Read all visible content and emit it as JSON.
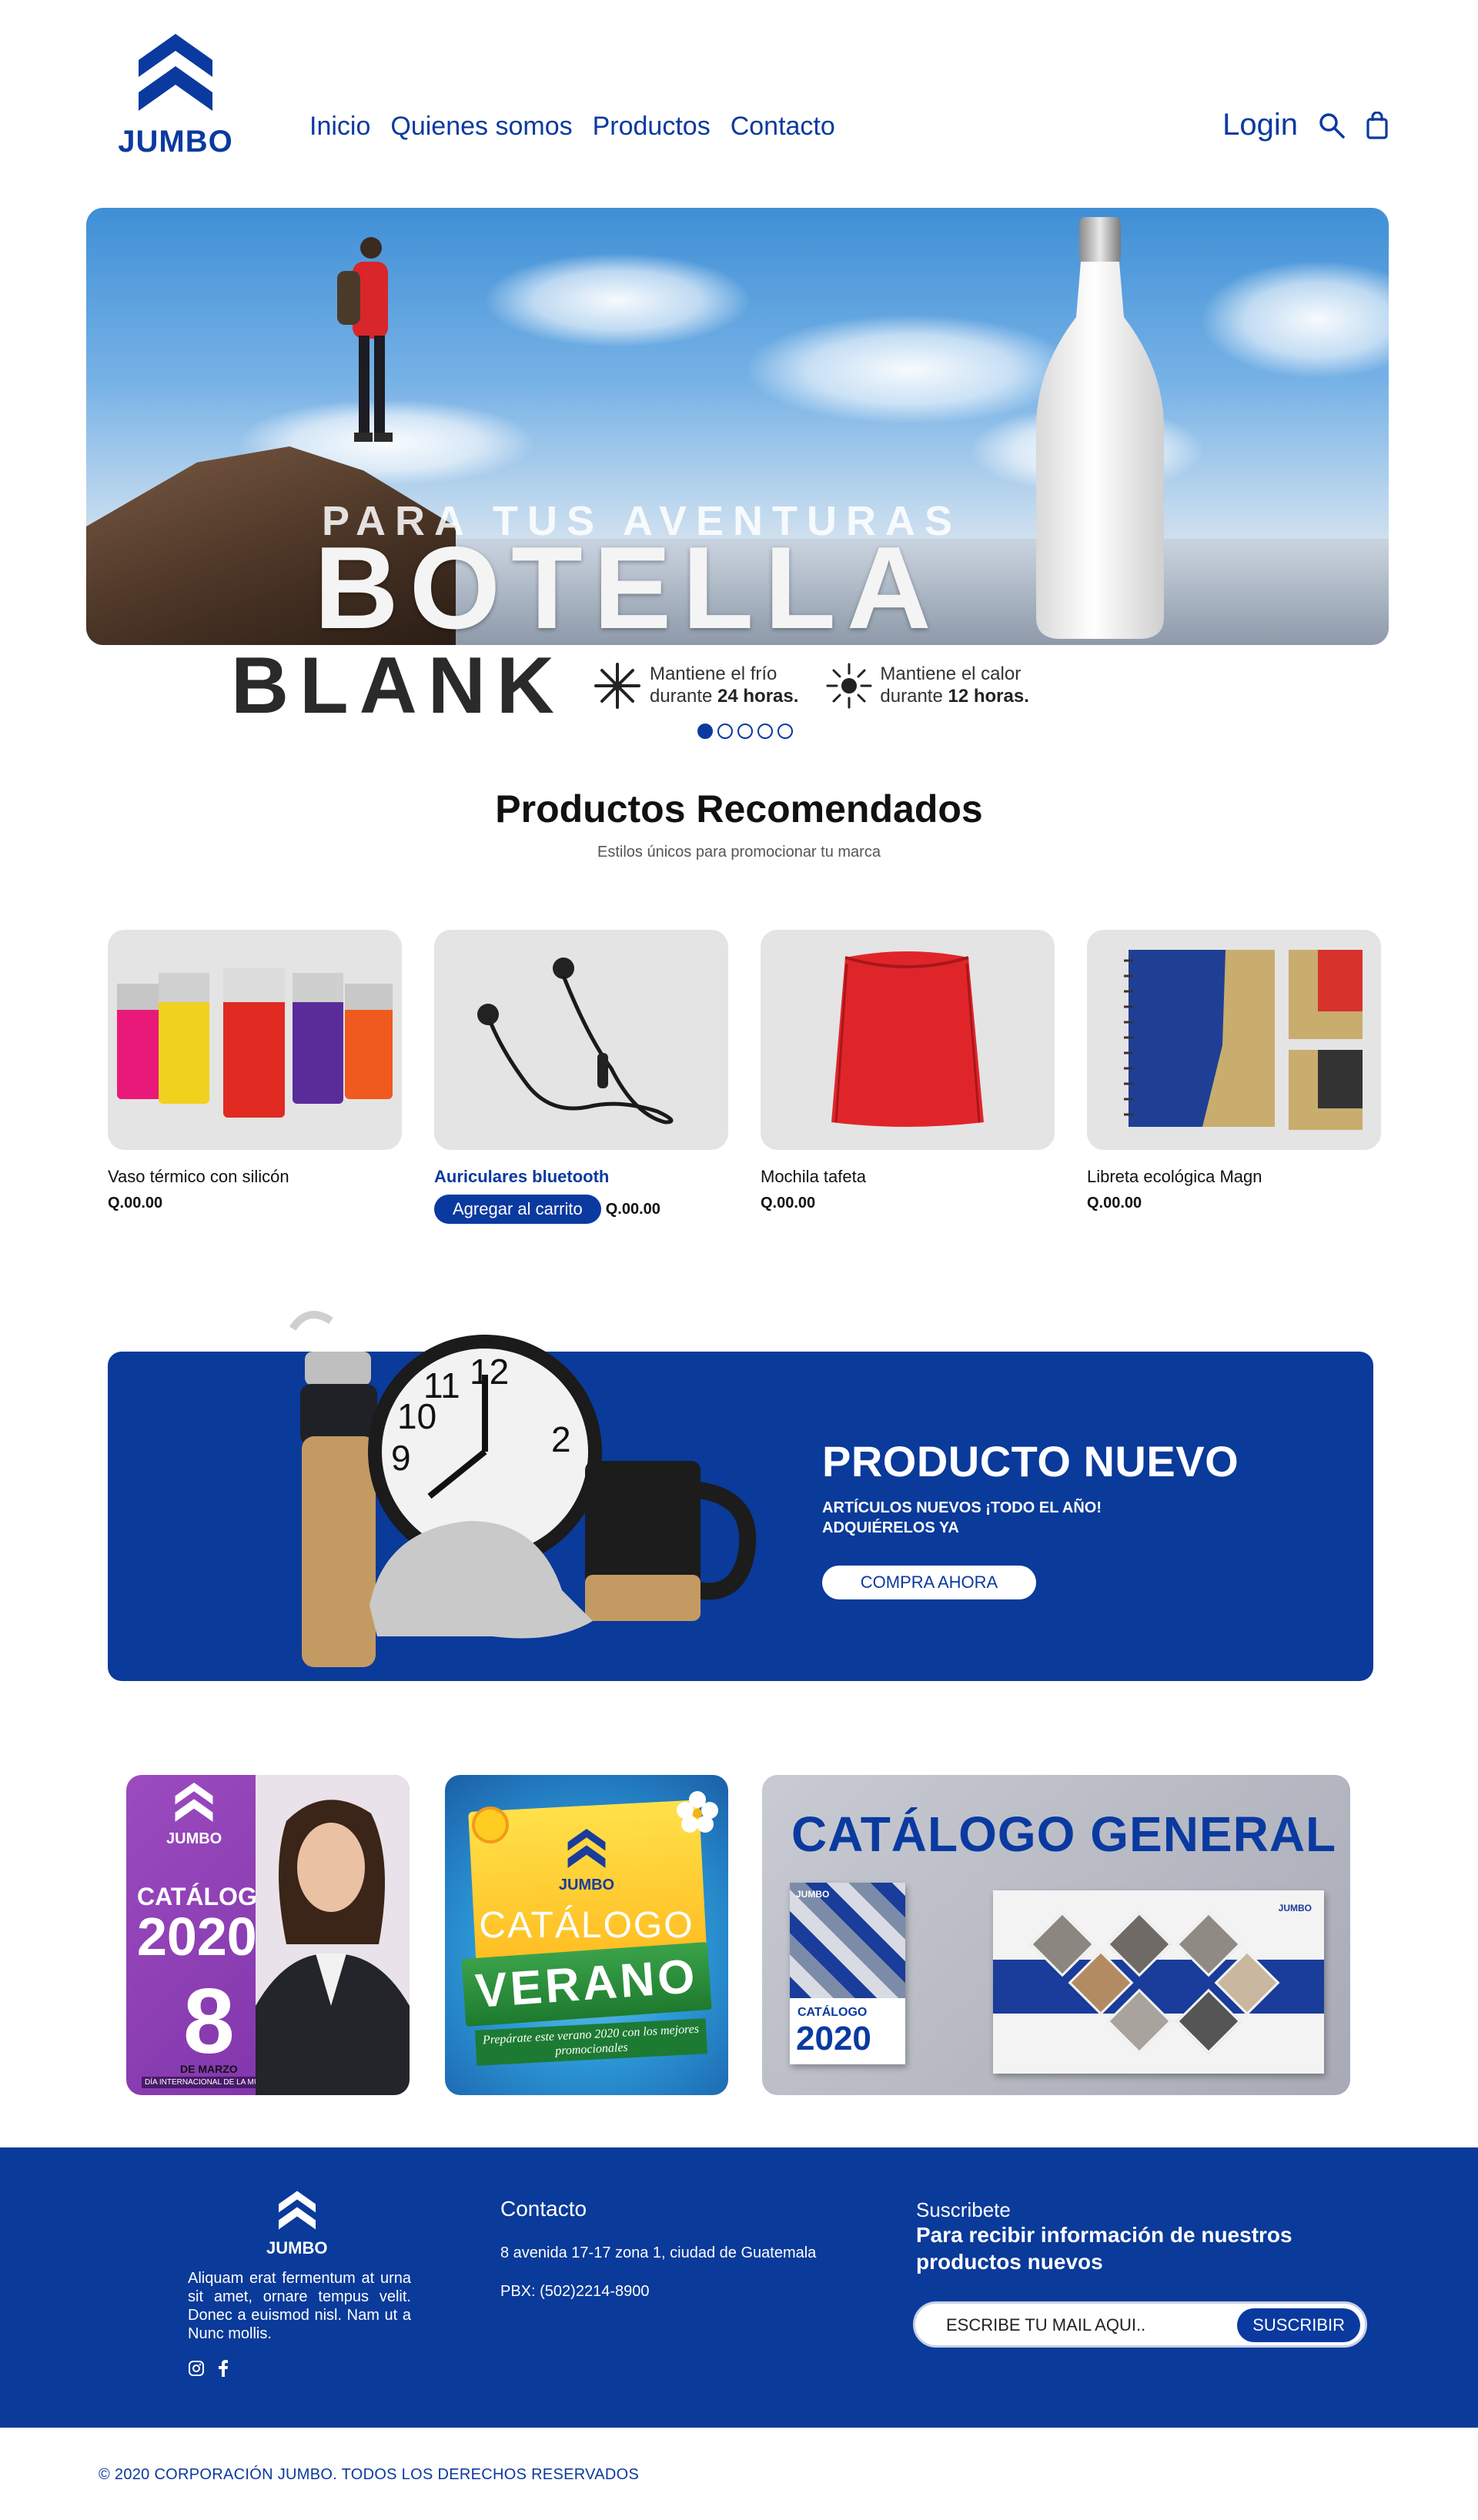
{
  "brand": {
    "name": "JUMBO",
    "color": "#0a3aa0"
  },
  "nav": {
    "items": [
      "Inicio",
      "Quienes somos",
      "Productos",
      "Contacto"
    ]
  },
  "header": {
    "login": "Login",
    "icons": [
      "search-icon",
      "shopping-bag-icon"
    ]
  },
  "hero": {
    "subtitle": "PARA TUS AVENTURAS",
    "title": "BOTELLA",
    "title2": "BLANK",
    "feature_cold_line1": "Mantiene el frío",
    "feature_cold_line2_pre": "durante ",
    "feature_cold_line2_bold": "24 horas.",
    "feature_hot_line1": "Mantiene el calor",
    "feature_hot_line2_pre": "durante ",
    "feature_hot_line2_bold": "12 horas.",
    "slides_total": 5,
    "slide_active": 1
  },
  "recommended": {
    "title": "Productos Recomendados",
    "subtitle": "Estilos únicos para promocionar tu marca",
    "products": [
      {
        "name": "Vaso térmico con silicón",
        "price": "Q.00.00"
      },
      {
        "name": "Auriculares bluetooth",
        "price": "Q.00.00",
        "button": "Agregar al carrito"
      },
      {
        "name": "Mochila tafeta",
        "price": "Q.00.00"
      },
      {
        "name": "Libreta ecológica Magn",
        "price": "Q.00.00"
      }
    ]
  },
  "new_product": {
    "title": "PRODUCTO NUEVO",
    "line1": "ARTÍCULOS NUEVOS ¡TODO EL AÑO!",
    "line2": "ADQUIÉRELOS YA",
    "button": "COMPRA AHORA"
  },
  "catalogs": {
    "c1": {
      "logo": "JUMBO",
      "label": "CATÁLOGO",
      "year": "2020",
      "day": "8",
      "month": "DE MARZO",
      "caption": "DÍA INTERNACIONAL DE LA MUJER"
    },
    "c2": {
      "logo": "JUMBO",
      "label": "CATÁLOGO",
      "season": "VERANO",
      "text": "Prepárate este verano 2020 con los mejores promocionales"
    },
    "c3": {
      "title": "CATÁLOGO GENERAL",
      "book_logo": "JUMBO",
      "book_label": "CATÁLOGO",
      "book_year": "2020",
      "spread_logo": "JUMBO"
    }
  },
  "footer": {
    "logo": "JUMBO",
    "about": "Aliquam erat fermentum at urna sit amet, ornare tempus velit. Donec a euismod nisl. Nam ut a Nunc mollis.",
    "social_icons": [
      "instagram-icon",
      "facebook-icon"
    ],
    "contact_heading": "Contacto",
    "address": "8 avenida 17-17 zona  1, ciudad de Guatemala",
    "phone": "PBX: (502)2214-8900",
    "subscribe_heading": "Suscribete",
    "subscribe_text": "Para recibir información de nuestros productos nuevos",
    "email_placeholder": "ESCRIBE TU MAIL AQUI..",
    "subscribe_button": "SUSCRIBIR"
  },
  "copyright": "© 2020 CORPORACIÓN JUMBO. TODOS LOS DERECHOS RESERVADOS"
}
